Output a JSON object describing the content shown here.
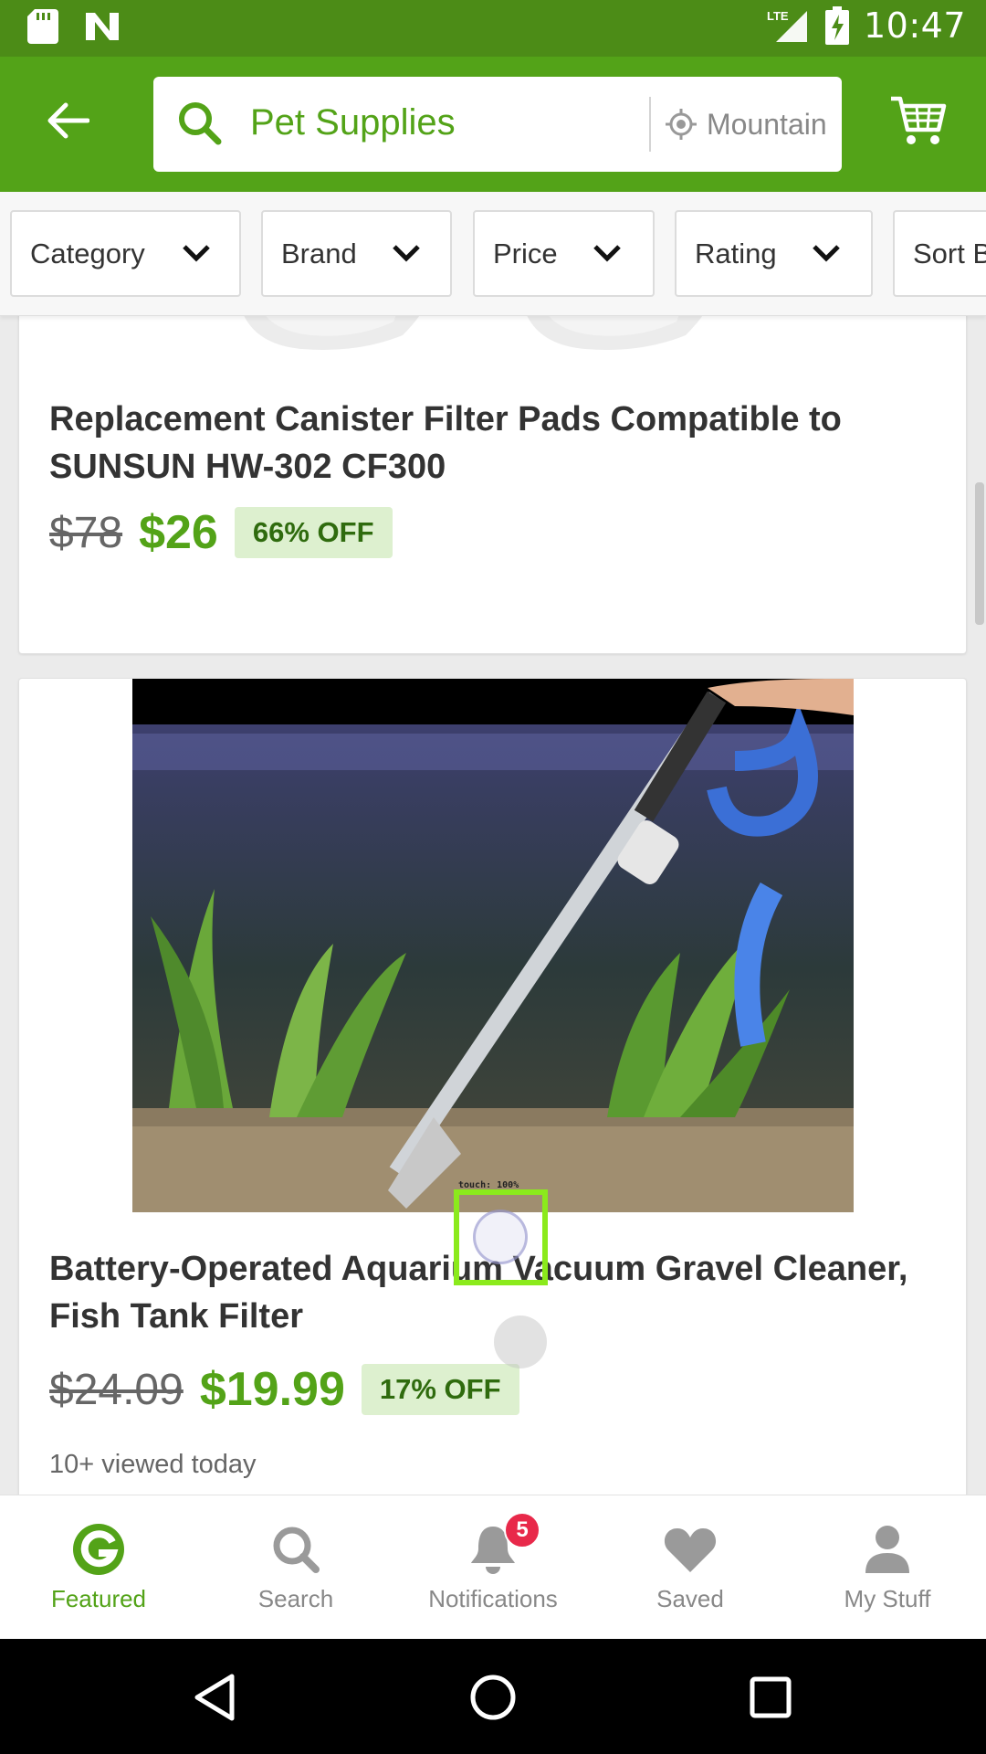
{
  "status_bar": {
    "time": "10:47",
    "network": "LTE",
    "icons": [
      "sd-card-icon",
      "n-logo-icon",
      "lte-signal-icon",
      "battery-charging-icon"
    ]
  },
  "toolbar": {
    "search_text": "Pet Supplies",
    "location_text": "Mountain",
    "icons": [
      "back-arrow-icon",
      "search-icon",
      "location-icon",
      "cart-icon"
    ]
  },
  "filters": [
    {
      "label": "Category"
    },
    {
      "label": "Brand"
    },
    {
      "label": "Price"
    },
    {
      "label": "Rating"
    },
    {
      "label": "Sort B"
    }
  ],
  "products": [
    {
      "title": "Replacement Canister Filter Pads Compatible to SUNSUN HW-302 CF300",
      "old_price": "$78",
      "new_price": "$26",
      "discount": "66% OFF"
    },
    {
      "title": "Battery-Operated Aquarium Vacuum Gravel Cleaner, Fish Tank Filter",
      "old_price": "$24.09",
      "new_price": "$19.99",
      "discount": "17% OFF",
      "viewed": "10+ viewed today"
    }
  ],
  "touch_overlay": {
    "label": "touch: 100%"
  },
  "bottom_nav": {
    "items": [
      {
        "label": "Featured",
        "active": true
      },
      {
        "label": "Search"
      },
      {
        "label": "Notifications",
        "badge": "5"
      },
      {
        "label": "Saved"
      },
      {
        "label": "My Stuff"
      }
    ]
  },
  "colors": {
    "brand_green": "#53a318",
    "status_green": "#4c8c17",
    "badge_red": "#e8294a",
    "discount_bg": "#ddf0cf"
  }
}
